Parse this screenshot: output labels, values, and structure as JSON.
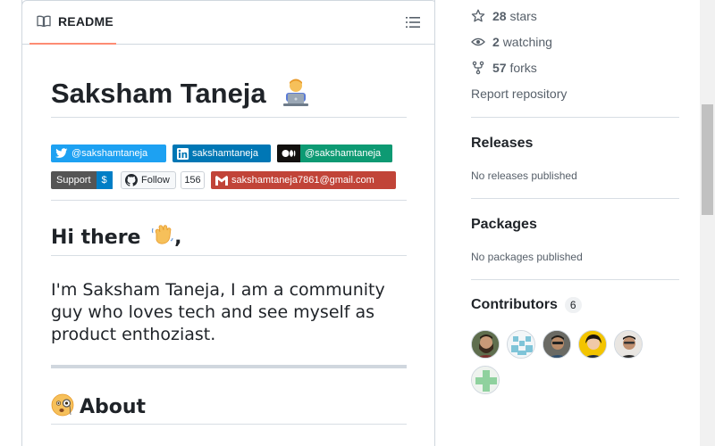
{
  "readme": {
    "tab_label": "README",
    "title": "Saksham Taneja",
    "badges": {
      "twitter": "@sakshamtaneja",
      "linkedin": "sakshamtaneja",
      "medium": "@sakshamtaneja",
      "support_left": "Support",
      "support_right": "$",
      "follow_label": "Follow",
      "follow_count": "156",
      "email": "sakshamtaneja7861@gmail.com"
    },
    "greeting": "Hi there",
    "greeting_suffix": ",",
    "intro": "I'm Saksham Taneja, I am a community guy who loves tech and see myself as product enthoziast.",
    "about_heading": "About"
  },
  "sidebar": {
    "stars_count": "28",
    "stars_label": "stars",
    "watching_count": "2",
    "watching_label": "watching",
    "forks_count": "57",
    "forks_label": "forks",
    "report": "Report repository",
    "releases_heading": "Releases",
    "releases_note": "No releases published",
    "packages_heading": "Packages",
    "packages_note": "No packages published",
    "contributors_heading": "Contributors",
    "contributors_count": "6"
  },
  "colors": {
    "twitter": "#1da1f2",
    "linkedin": "#0077b5",
    "medium": "#12100e",
    "support_left": "#555555",
    "support_right": "#007ec6",
    "email": "#c14438",
    "tab_underline": "#fd8c73"
  },
  "icons": [
    "book-icon",
    "list-icon",
    "star-icon",
    "eye-icon",
    "fork-icon",
    "twitter-icon",
    "linkedin-icon",
    "medium-icon",
    "github-icon",
    "gmail-icon"
  ]
}
